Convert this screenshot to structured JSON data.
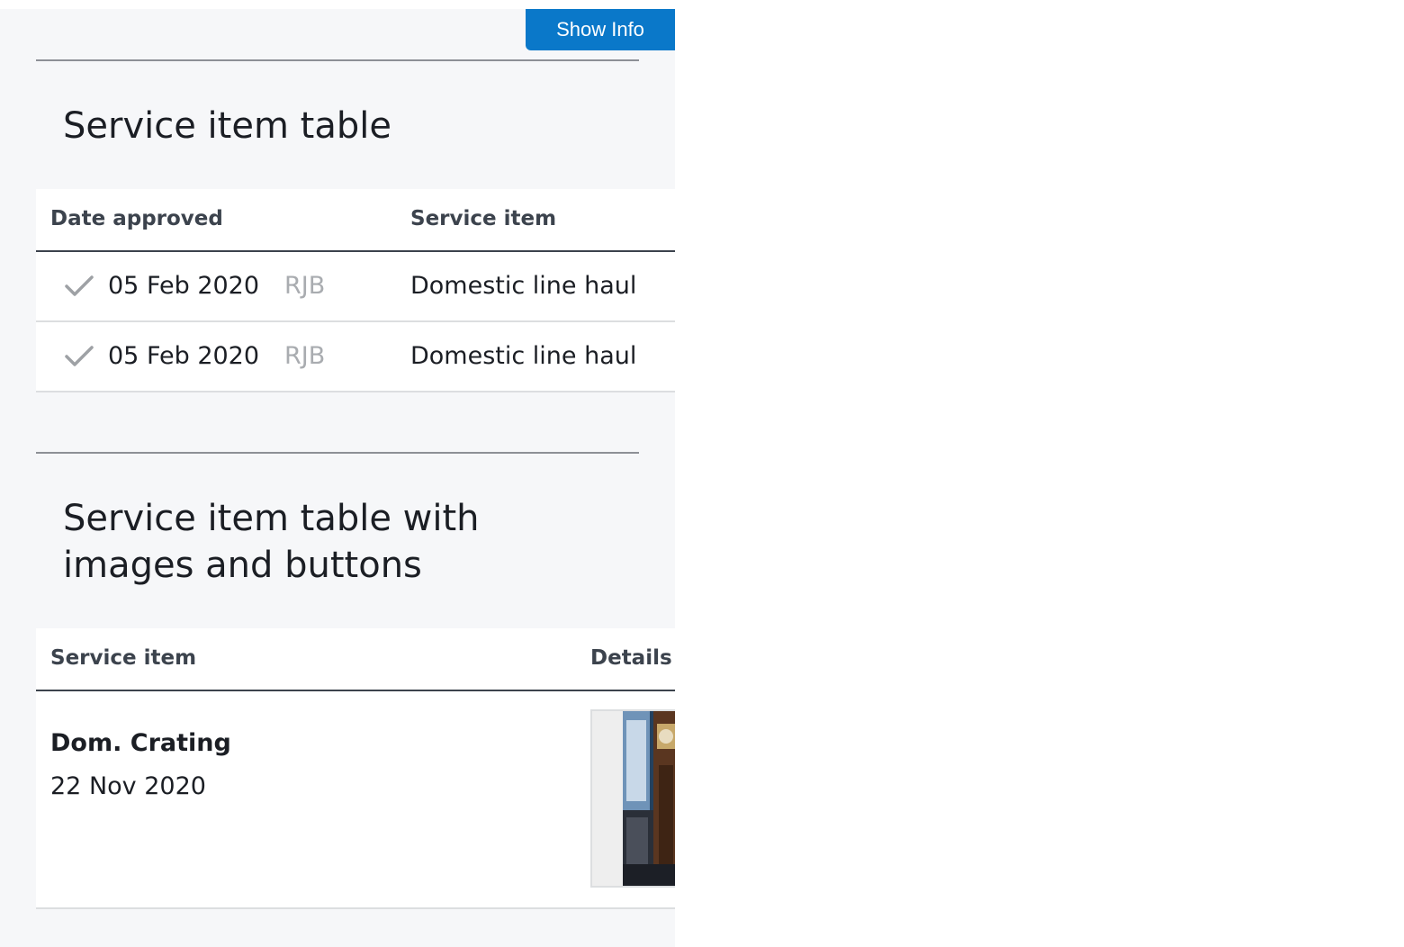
{
  "toolbar": {
    "show_info_label": "Show Info"
  },
  "section1": {
    "title": "Service item table",
    "columns": [
      "Date approved",
      "Service item"
    ],
    "rows": [
      {
        "status_icon": "check-icon",
        "date": "05 Feb 2020",
        "initials": "RJB",
        "service_item": "Domestic line haul"
      },
      {
        "status_icon": "check-icon",
        "date": "05 Feb 2020",
        "initials": "RJB",
        "service_item": "Domestic line haul"
      }
    ]
  },
  "section2": {
    "title_line1": "Service item table with",
    "title_line2": "images and buttons",
    "columns": [
      "Service item",
      "Details"
    ],
    "rows": [
      {
        "name": "Dom. Crating",
        "date": "22 Nov 2020",
        "image": "grandfather-clock-photo"
      }
    ]
  },
  "colors": {
    "primary": "#0a78c9",
    "panel_background": "#f6f7f9",
    "text": "#1b1e24",
    "header_text": "#3c434d",
    "muted": "#a9acb0"
  }
}
